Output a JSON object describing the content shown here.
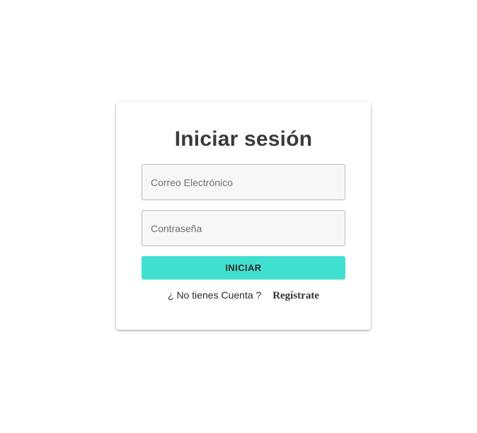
{
  "login": {
    "title": "Iniciar sesión",
    "email_placeholder": "Correo Electrónico",
    "password_placeholder": "Contraseña",
    "submit_label": "INICIAR",
    "register_question": "¿ No tienes Cuenta ?",
    "register_link": "Regístrate"
  },
  "colors": {
    "accent": "#40e0d0",
    "input_bg": "#f6f7f9",
    "title_text": "#3a3a3a"
  }
}
